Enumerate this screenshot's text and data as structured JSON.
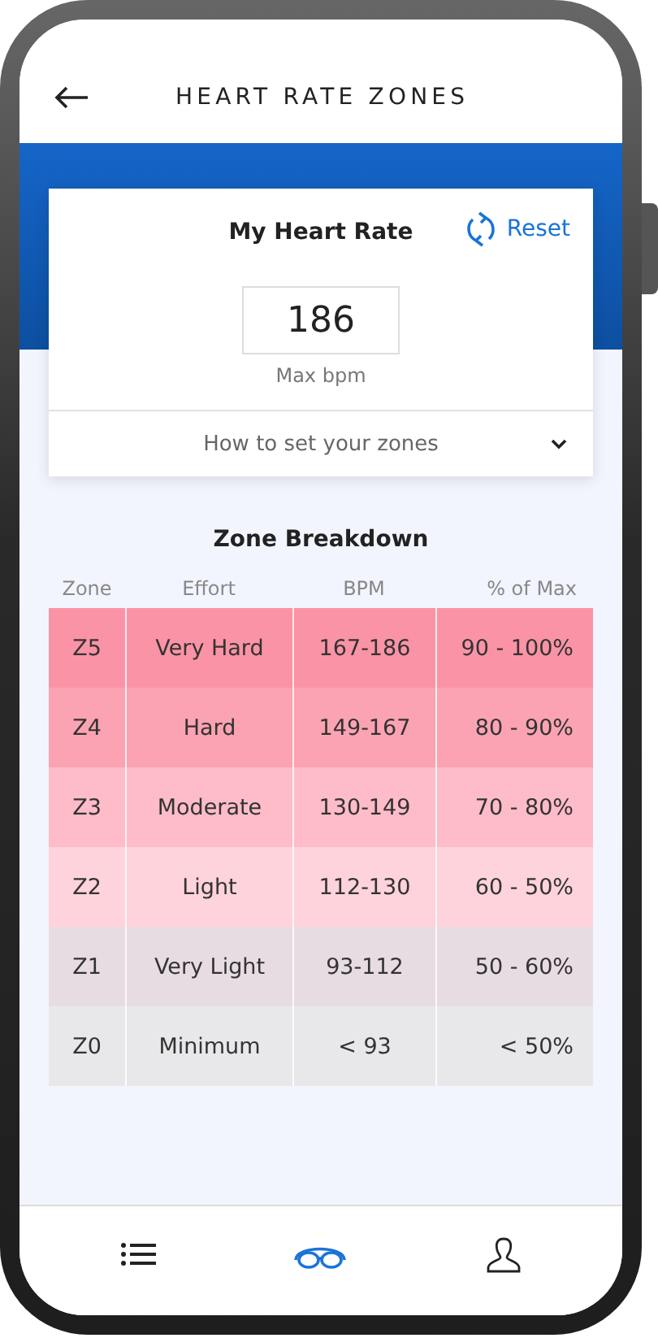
{
  "header": {
    "title": "HEART RATE ZONES"
  },
  "heart_rate_card": {
    "title": "My Heart Rate",
    "reset": "Reset",
    "max_bpm": "186",
    "max_bpm_label": "Max bpm",
    "help": "How to set your zones",
    "help_expanded": false
  },
  "zone_breakdown": {
    "title": "Zone Breakdown",
    "columns": [
      "Zone",
      "Effort",
      "BPM",
      "% of Max"
    ],
    "rows": [
      {
        "zone": "Z5",
        "effort": "Very Hard",
        "bpm": "167-186",
        "percent": "90 - 100%",
        "color": "#fb93a6"
      },
      {
        "zone": "Z4",
        "effort": "Hard",
        "bpm": "149-167",
        "percent": "80 - 90%",
        "color": "#fba3b3"
      },
      {
        "zone": "Z3",
        "effort": "Moderate",
        "bpm": "130-149",
        "percent": "70 - 80%",
        "color": "#fdbcc8"
      },
      {
        "zone": "Z2",
        "effort": "Light",
        "bpm": "112-130",
        "percent": "60 - 50%",
        "color": "#fed3db"
      },
      {
        "zone": "Z1",
        "effort": "Very Light",
        "bpm": "93-112",
        "percent": "50 - 60%",
        "color": "#e8dce3"
      },
      {
        "zone": "Z0",
        "effort": "Minimum",
        "bpm": "< 93",
        "percent": "< 50%",
        "color": "#e8e8ea"
      }
    ]
  },
  "nav": [
    {
      "kind": "list",
      "selected": false
    },
    {
      "kind": "goggles",
      "selected": true
    },
    {
      "kind": "person",
      "selected": false
    }
  ]
}
